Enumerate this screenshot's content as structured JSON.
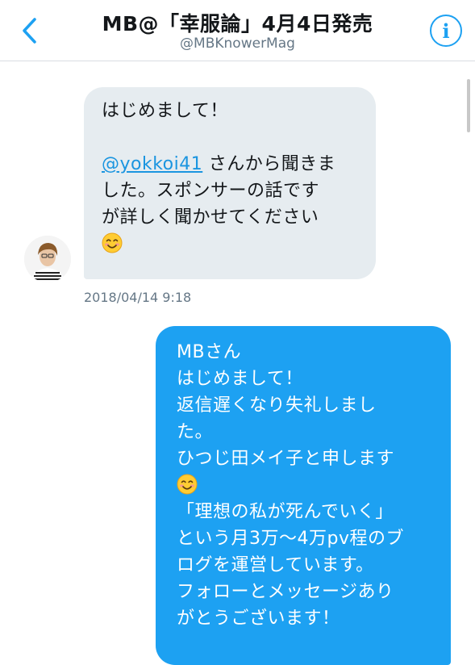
{
  "header": {
    "title": "MB@「幸服論」4月4日発売",
    "handle": "@MBKnowerMag",
    "back_icon": "chevron-left-icon",
    "info_icon": "info-icon"
  },
  "colors": {
    "accent": "#1da1f2",
    "incoming_bubble": "#e6ecf0",
    "muted_text": "#657786"
  },
  "messages": [
    {
      "direction": "incoming",
      "line1": "はじめまして！",
      "mention": "@yokkoi41",
      "line2_rest": " さんから聞きま",
      "line3": "した。スポンサーの話です",
      "line4": "が詳しく聞かせてください",
      "emoji": "smiling-face-emoji",
      "timestamp": "2018/04/14 9:18"
    },
    {
      "direction": "outgoing",
      "lines": [
        "MBさん",
        "はじめまして！",
        "返信遅くなり失礼しまし",
        "た。",
        "ひつじ田メイ子と申します",
        "",
        "「理想の私が死んでいく」",
        "という月3万〜4万pv程のブ",
        "ログを運営しています。",
        "フォローとメッセージあり",
        "がとうございます！"
      ],
      "emoji": "smiling-face-emoji"
    }
  ]
}
